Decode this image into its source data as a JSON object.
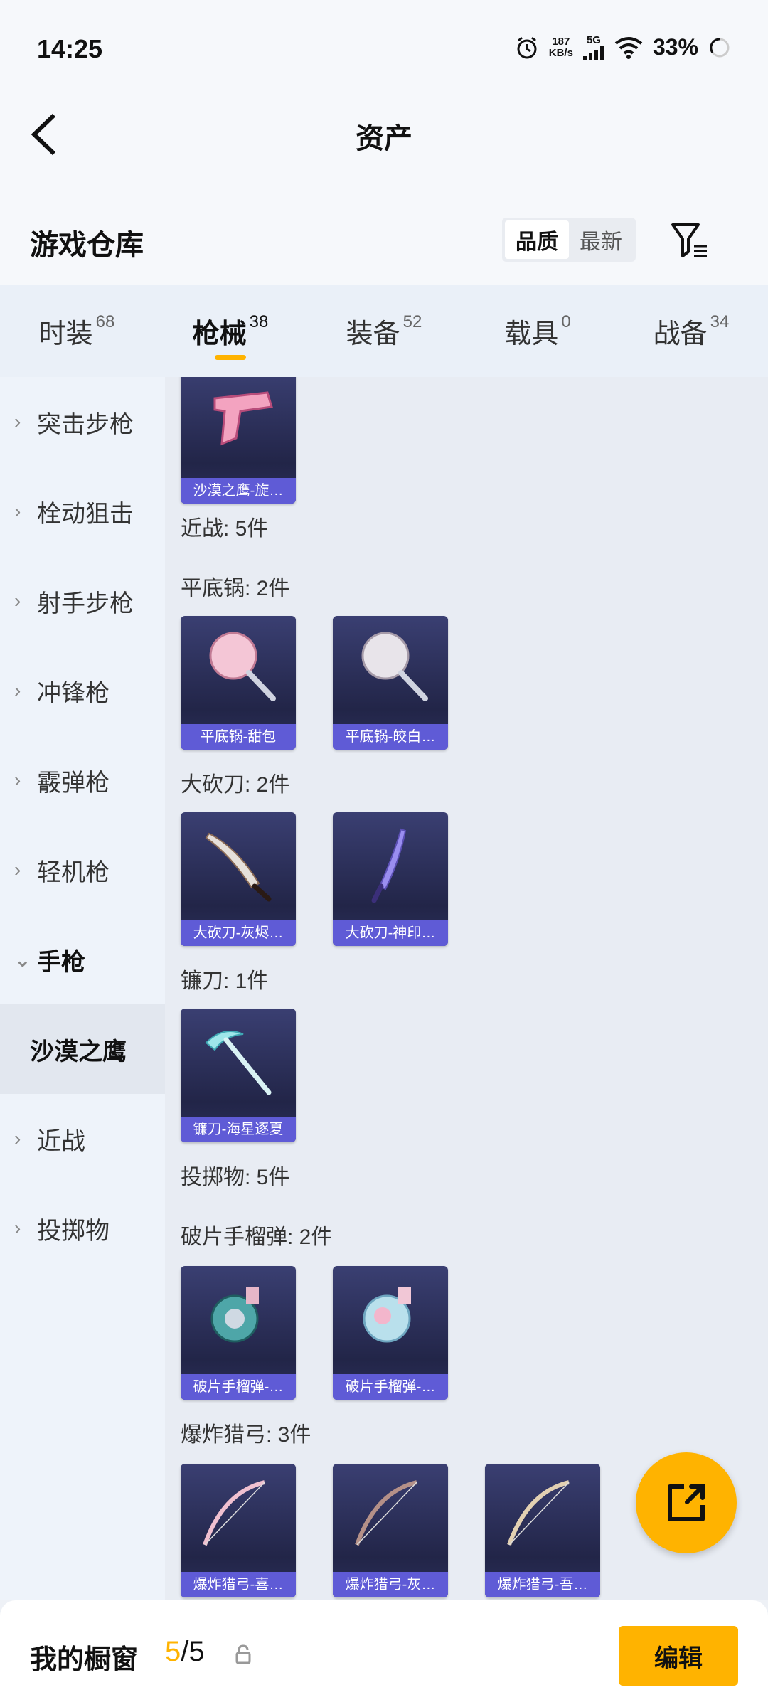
{
  "status": {
    "time": "14:25",
    "speed_value": "187",
    "speed_unit": "KB/s",
    "network": "5G",
    "battery": "33%"
  },
  "header": {
    "title": "资产"
  },
  "warehouse": {
    "title": "游戏仓库",
    "sort_options": [
      "品质",
      "最新"
    ],
    "sort_active": "品质"
  },
  "tabs": [
    {
      "label": "时装",
      "count": "68"
    },
    {
      "label": "枪械",
      "count": "38",
      "active": true
    },
    {
      "label": "装备",
      "count": "52"
    },
    {
      "label": "载具",
      "count": "0"
    },
    {
      "label": "战备",
      "count": "34"
    }
  ],
  "sidebar": {
    "items": [
      "突击步枪",
      "栓动狙击",
      "射手步枪",
      "冲锋枪",
      "霰弹枪",
      "轻机枪",
      "手枪",
      "近战",
      "投掷物"
    ],
    "open_item": "手枪",
    "sub_item": "沙漠之鹰"
  },
  "content": {
    "top_card": "沙漠之鹰-旋…",
    "groups": [
      {
        "title": "近战: 5件"
      },
      {
        "title": "平底锅: 2件",
        "items": [
          "平底锅-甜包",
          "平底锅-皎白…"
        ]
      },
      {
        "title": "大砍刀: 2件",
        "items": [
          "大砍刀-灰烬…",
          "大砍刀-神印…"
        ]
      },
      {
        "title": "镰刀: 1件",
        "items": [
          "镰刀-海星逐夏"
        ]
      },
      {
        "title": "投掷物: 5件"
      },
      {
        "title": "破片手榴弹: 2件",
        "items": [
          "破片手榴弹-…",
          "破片手榴弹-…"
        ]
      },
      {
        "title": "爆炸猎弓: 3件",
        "items": [
          "爆炸猎弓-喜…",
          "爆炸猎弓-灰…",
          "爆炸猎弓-吾…"
        ]
      }
    ]
  },
  "bottom": {
    "label": "我的橱窗",
    "used": "5",
    "separator": "/",
    "total": "5",
    "edit": "编辑"
  },
  "colors": {
    "accent": "#ffb300",
    "card_caption": "#5f5bd6",
    "card_bg": "#2b2f5a"
  }
}
